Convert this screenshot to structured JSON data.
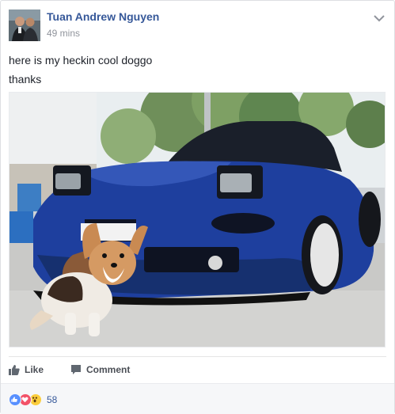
{
  "post": {
    "author": "Tuan Andrew Nguyen",
    "timestamp": "49 mins",
    "text_lines": [
      "here is my heckin cool doggo",
      "thanks"
    ]
  },
  "actions": {
    "like_label": "Like",
    "comment_label": "Comment"
  },
  "reactions": {
    "types": [
      "like",
      "love",
      "wow"
    ],
    "count": "58"
  },
  "colors": {
    "author_link": "#365899",
    "meta_gray": "#90949c",
    "like_blue": "#5890ff",
    "love_red": "#f25268",
    "wow_yellow": "#fbcd3c"
  },
  "icons": [
    "chevron-down-icon",
    "thumbs-up-icon",
    "comment-bubble-icon"
  ]
}
